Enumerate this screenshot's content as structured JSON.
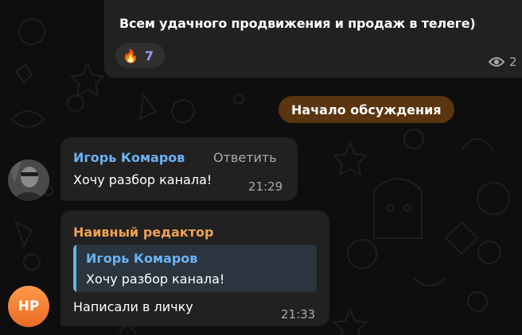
{
  "colors": {
    "background": "#0e0e0e",
    "bubble": "#212121",
    "service_pill": "#5b3510",
    "author_blue": "#6ab3f3",
    "author_orange": "#f0a250",
    "reaction_count": "#a695e7",
    "quote_bar": "#5fb7f0",
    "avatar_gradient": "#ea6a24"
  },
  "channel_post": {
    "text": "Всем удачного продвижения и продаж в телеге)",
    "reaction": {
      "icon": "fire-emoji-icon",
      "emoji": "🔥",
      "count": "7"
    },
    "views": {
      "icon": "eye-icon",
      "count": "2"
    }
  },
  "service_message": {
    "label": "Начало обсуждения"
  },
  "comments": [
    {
      "author": "Игорь Комаров",
      "reply_label": "Ответить",
      "text": "Хочу разбор канала!",
      "time": "21:29",
      "avatar": "user-photo-avatar"
    },
    {
      "author": "Наивный редактор",
      "avatar_initials": "НР",
      "quote": {
        "author": "Игорь Комаров",
        "text": "Хочу разбор канала!"
      },
      "text": "Написали в личку",
      "time": "21:33"
    }
  ]
}
